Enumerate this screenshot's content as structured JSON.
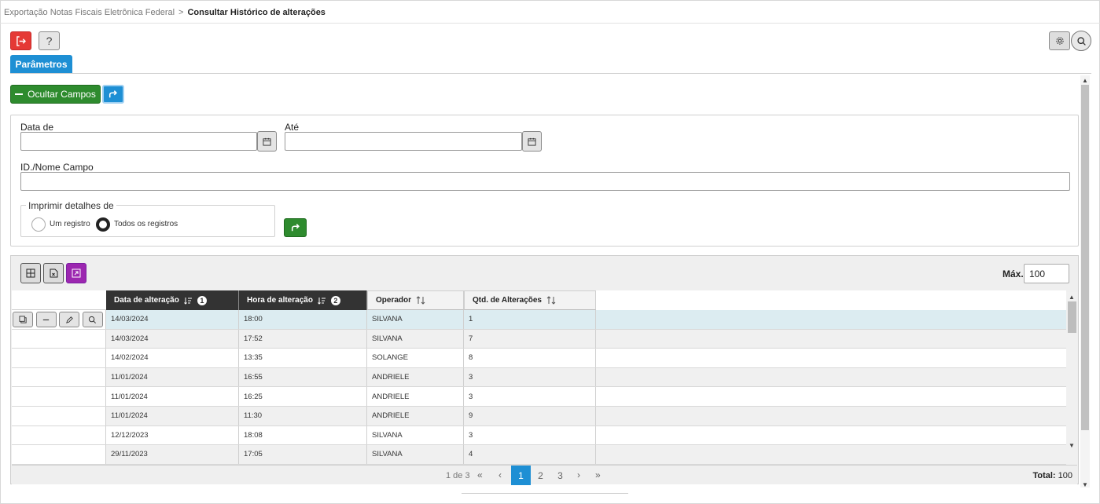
{
  "breadcrumb": {
    "parent": "Exportação Notas Fiscais Eletrônica Federal",
    "separator": ">",
    "current": "Consultar Histórico de alterações"
  },
  "toolbar": {
    "exit_icon": "exit-icon",
    "help_label": "?"
  },
  "tab": {
    "label": "Parâmetros"
  },
  "actions": {
    "hide_fields_label": "Ocultar Campos"
  },
  "filters": {
    "date_from_label": "Data de",
    "date_from_value": "",
    "date_to_label": "Até",
    "date_to_value": "",
    "id_name_label": "ID./Nome Campo",
    "id_name_value": "",
    "print_details_legend": "Imprimir detalhes de",
    "print_options": [
      {
        "label": "Um registro",
        "selected": false
      },
      {
        "label": "Todos os registros",
        "selected": true
      }
    ]
  },
  "grid": {
    "max_label": "Máx.",
    "max_value": "100",
    "columns": [
      {
        "label": "Data de alteração",
        "sort_order": "1"
      },
      {
        "label": "Hora de alteração",
        "sort_order": "2"
      },
      {
        "label": "Operador"
      },
      {
        "label": "Qtd. de Alterações"
      }
    ],
    "rows": [
      {
        "date": "14/03/2024",
        "time": "18:00",
        "operator": "SILVANA",
        "count": "1"
      },
      {
        "date": "14/03/2024",
        "time": "17:52",
        "operator": "SILVANA",
        "count": "7"
      },
      {
        "date": "14/02/2024",
        "time": "13:35",
        "operator": "SOLANGE",
        "count": "8"
      },
      {
        "date": "11/01/2024",
        "time": "16:55",
        "operator": "ANDRIELE",
        "count": "3"
      },
      {
        "date": "11/01/2024",
        "time": "16:25",
        "operator": "ANDRIELE",
        "count": "3"
      },
      {
        "date": "11/01/2024",
        "time": "11:30",
        "operator": "ANDRIELE",
        "count": "9"
      },
      {
        "date": "12/12/2023",
        "time": "18:08",
        "operator": "SILVANA",
        "count": "3"
      },
      {
        "date": "29/11/2023",
        "time": "17:05",
        "operator": "SILVANA",
        "count": "4"
      }
    ]
  },
  "pager": {
    "info": "1 de 3",
    "pages": [
      "1",
      "2",
      "3"
    ],
    "current_page": "1",
    "first": "«",
    "prev": "‹",
    "next": "›",
    "last": "»",
    "total_label": "Total:",
    "total_value": "100"
  },
  "colors": {
    "primary": "#1e8fd4",
    "success": "#2e8b2e",
    "danger": "#e53935",
    "purple": "#9c27b0",
    "selected_row": "#dcecf1"
  }
}
